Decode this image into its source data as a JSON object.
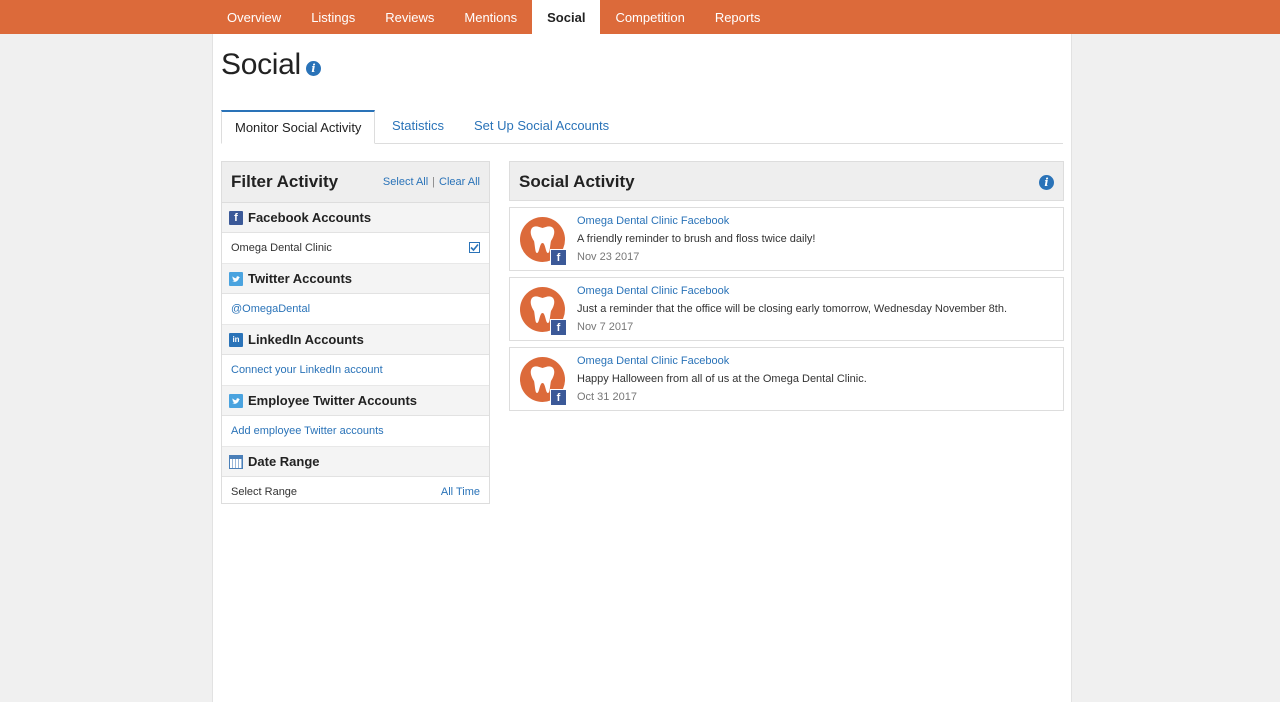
{
  "topnav": {
    "tabs": [
      "Overview",
      "Listings",
      "Reviews",
      "Mentions",
      "Social",
      "Competition",
      "Reports"
    ],
    "active": "Social"
  },
  "page": {
    "title": "Social"
  },
  "subtabs": {
    "items": [
      "Monitor Social Activity",
      "Statistics",
      "Set Up Social Accounts"
    ],
    "active": "Monitor Social Activity"
  },
  "filter": {
    "title": "Filter Activity",
    "select_all": "Select All",
    "separator": "|",
    "clear_all": "Clear All",
    "facebook": {
      "label": "Facebook Accounts",
      "icon": "facebook-icon",
      "account": "Omega Dental Clinic",
      "checked": true
    },
    "twitter": {
      "label": "Twitter Accounts",
      "icon": "twitter-icon",
      "account": "@OmegaDental"
    },
    "linkedin": {
      "label": "LinkedIn Accounts",
      "icon": "linkedin-icon",
      "link": "Connect your LinkedIn account"
    },
    "employee_twitter": {
      "label": "Employee Twitter Accounts",
      "icon": "twitter-icon",
      "link": "Add employee Twitter accounts"
    },
    "date_range": {
      "label": "Date Range",
      "icon": "calendar-icon",
      "row_label": "Select Range",
      "value": "All Time"
    }
  },
  "activity": {
    "title": "Social Activity",
    "posts": [
      {
        "source": "Omega Dental Clinic Facebook",
        "message": "A friendly reminder to brush and floss twice daily!",
        "date": "Nov 23 2017"
      },
      {
        "source": "Omega Dental Clinic Facebook",
        "message": "Just a reminder that the office will be closing early tomorrow, Wednesday November 8th.",
        "date": "Nov 7 2017"
      },
      {
        "source": "Omega Dental Clinic Facebook",
        "message": "Happy Halloween from all of us at the Omega Dental Clinic.",
        "date": "Oct 31 2017"
      }
    ]
  },
  "colors": {
    "brand_orange": "#dc6a3a",
    "link_blue": "#2a73b8",
    "facebook_blue": "#3b5998"
  }
}
